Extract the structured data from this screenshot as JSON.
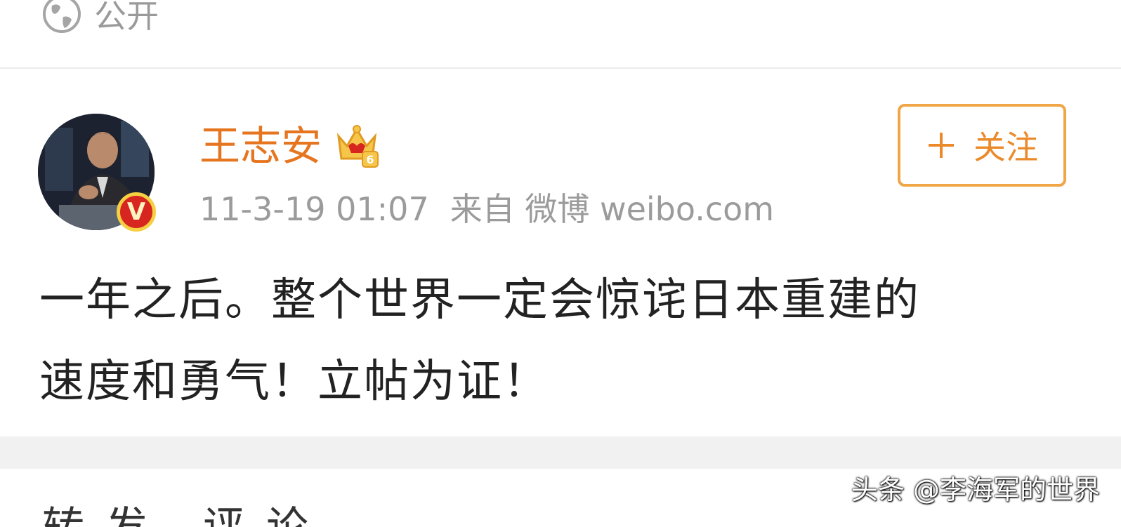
{
  "top": {
    "visibility_label": "公开"
  },
  "post": {
    "author": "王志安",
    "level_badge_icon": "crown-level-6-icon",
    "verified_badge": "V",
    "timestamp": "11-3-19 01:07",
    "source_prefix": "来自",
    "source": "微博 weibo.com",
    "follow_label": "关注",
    "text_line1": "一年之后。整个世界一定会惊诧日本重建的",
    "text_line2": "速度和勇气！立帖为证！"
  },
  "next_card": {
    "peek_text": "转发 评论"
  },
  "watermark": "头条 @李海军的世界",
  "colors": {
    "username": "#e6751f",
    "follow_border": "#f0a646",
    "verified": "#d7261f",
    "meta": "#9b9b9b"
  }
}
